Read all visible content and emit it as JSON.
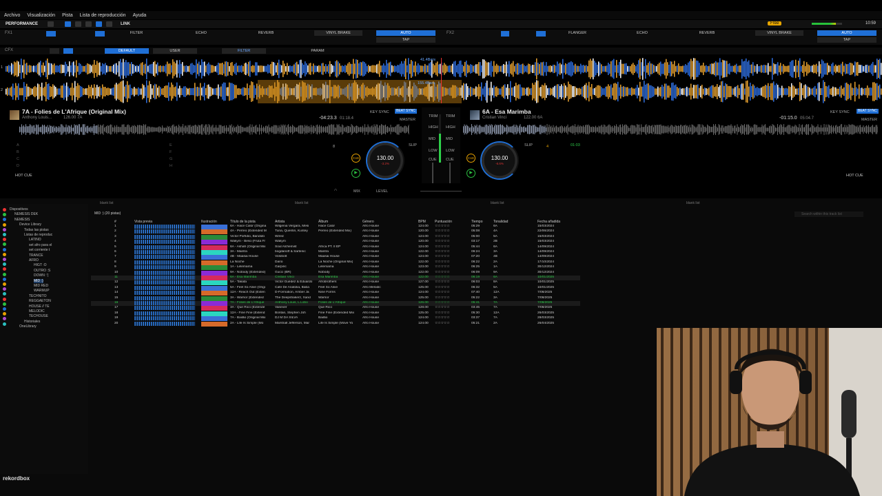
{
  "menu": [
    "Archivo",
    "Visualización",
    "Pista",
    "Lista de reproducción",
    "Ayuda"
  ],
  "toolbar": {
    "mode": "PERFORMANCE",
    "link": "LINK",
    "free": "Free",
    "clock": "10:59"
  },
  "fx": {
    "fx1_label": "FX1",
    "fx2_label": "FX2",
    "cfx_label": "CFX",
    "deck1": [
      "FILTER",
      "ECHO",
      "REVERB",
      "VINYL BRAKE"
    ],
    "deck2": [
      "FLANGER",
      "ECHO",
      "REVERB",
      "VINYL BRAKE"
    ],
    "auto": "AUTO",
    "tap": "TAP",
    "cfx_tabs": [
      "DEFAULT",
      "USER"
    ],
    "cfx_filter": "FILTER",
    "cfx_param": "PARAM"
  },
  "waveform": {
    "bars_top": "41.4Bars",
    "bars_bottom": "155.4Bars",
    "top_bars_lane": "1",
    "bottom_bars_lane": "2"
  },
  "deck1": {
    "title": "7A - Folies de L'Afrique (Original Mix)",
    "artist": "Anthony Louis...",
    "info": "126.00 7A",
    "time_remaining": "-04:23.3",
    "time_total": "01:18.4",
    "bpm": "130.00",
    "bpm_pct": "-3.2%",
    "key_sync": "KEY SYNC",
    "beat_sync": "BEAT SYNC",
    "master": "MASTER",
    "cue": "CUE",
    "hot_cue": "HOT CUE",
    "slip": "SLIP",
    "loop": "8",
    "pad_letters": [
      "A",
      "B",
      "C",
      "D"
    ],
    "pad_letters_right": [
      "E",
      "F",
      "G",
      "H"
    ]
  },
  "deck2": {
    "title": "6A - Esa Marimba",
    "artist": "Cristian Vinci",
    "info": "122.00 6A",
    "time_remaining": "-01:15.0",
    "time_total": "05:04.7",
    "bpm": "130.00",
    "bpm_pct": "-6.6%",
    "key_sync": "KEY SYNC",
    "beat_sync": "BEAT SYNC",
    "master": "MASTER",
    "cue": "CUE",
    "hot_cue": "HOT CUE",
    "slip": "SLIP",
    "loop": "4",
    "hotcue_time": "01:03"
  },
  "mixer": {
    "trim": "TRIM",
    "high": "HIGH",
    "mid": "MID",
    "low": "LOW",
    "cue": "CUE",
    "mix": "MIX",
    "level": "LEVEL"
  },
  "browser": {
    "panes": [
      "blank list",
      "blank list",
      "blank list",
      "blank list"
    ],
    "search_placeholder": "Search within this track list",
    "list_title": "MID :) (20 pistas)",
    "columns": [
      "#",
      "Vista previa",
      "Ilustración",
      "Título de la pista",
      "Artista",
      "Álbum",
      "Género",
      "BPM",
      "Puntuación",
      "Tiempo",
      "Tonalidad",
      "Fecha añadida"
    ],
    "tracks": [
      {
        "n": "1",
        "title": "6A - Hace Calor (Origina",
        "artist": "Wilgenia Vergara, Mesi",
        "album": "Hace Calor",
        "genre": "Afro House",
        "bpm": "124.00",
        "time": "05:29",
        "key": "6A",
        "date": "15/03/2024"
      },
      {
        "n": "2",
        "title": "4A - Perreo (Extended M",
        "artist": "Tuna, Quentin, Kuntey",
        "album": "Perreo (Extended Mix)",
        "genre": "Afro House",
        "bpm": "120.00",
        "time": "05:08",
        "key": "4A",
        "date": "22/06/2024"
      },
      {
        "n": "3",
        "title": "Victor Porfidio, Bandido",
        "artist": "Wired",
        "album": "",
        "genre": "Afro House",
        "bpm": "124.00",
        "time": "05:00",
        "key": "5A",
        "date": "15/03/2024"
      },
      {
        "n": "4",
        "title": "Wakym - Beso (Fruta Fr",
        "artist": "Wakym",
        "album": "",
        "genre": "Afro House",
        "bpm": "120.00",
        "time": "03:17",
        "key": "2B",
        "date": "15/03/2024"
      },
      {
        "n": "5",
        "title": "6A - Ashah (Original Mix",
        "artist": "Soul Alchemist",
        "album": "Africa PT. II EP",
        "genre": "Afro House",
        "bpm": "124.00",
        "time": "05:44",
        "key": "6A",
        "date": "14/09/2024"
      },
      {
        "n": "6",
        "title": "3A - Mantra",
        "artist": "bogdanoff & Sartenic",
        "album": "Mantra",
        "genre": "Afro House",
        "bpm": "122.00",
        "time": "06:24",
        "key": "3A",
        "date": "14/09/2024"
      },
      {
        "n": "7",
        "title": "4B - Maasai House",
        "artist": "Volobott",
        "album": "Maasai House",
        "genre": "Afro House",
        "bpm": "124.00",
        "time": "07:20",
        "key": "4B",
        "date": "14/09/2024"
      },
      {
        "n": "8",
        "title": "La Noche",
        "artist": "Dario",
        "album": "La Noche (Original Mix)",
        "genre": "Afro House",
        "bpm": "122.00",
        "time": "06:22",
        "key": "2A",
        "date": "17/10/2024"
      },
      {
        "n": "9",
        "title": "1A - Lelemama",
        "artist": "Garpinc",
        "album": "Lelemama",
        "genre": "Afro House",
        "bpm": "123.00",
        "time": "06:25",
        "key": "1A",
        "date": "30/12/2024"
      },
      {
        "n": "10",
        "title": "9A - Nobody (Extended)",
        "artist": "Gucci (BR)",
        "album": "Nobody",
        "genre": "Afro House",
        "bpm": "122.00",
        "time": "06:09",
        "key": "9A",
        "date": "30/12/2024"
      },
      {
        "n": "11",
        "title": "6A - Esa Marimba",
        "artist": "Cristian Vinci",
        "album": "Esa Marimba",
        "genre": "Afro House",
        "bpm": "122.00",
        "time": "06:19",
        "key": "6A",
        "date": "10/01/2025",
        "green": true
      },
      {
        "n": "12",
        "title": "5A - Takata",
        "artist": "Victor Guédez & Eduardo",
        "album": "Afrobrothers",
        "genre": "Afro House",
        "bpm": "127.00",
        "time": "06:03",
        "key": "8A",
        "date": "10/01/2025"
      },
      {
        "n": "13",
        "title": "5A - Feel So Alive (Origi",
        "artist": "Cafe De Anatolia, Baba",
        "album": "Feel So Alive",
        "genre": "Afro Melodic",
        "bpm": "125.00",
        "time": "06:32",
        "key": "5A",
        "date": "10/01/2025"
      },
      {
        "n": "14",
        "title": "12A - Reach Out (Exten",
        "artist": "D-Formation, Amber Ja",
        "album": "Nine Forms",
        "genre": "Afro House",
        "bpm": "124.00",
        "time": "07:40",
        "key": "12A",
        "date": "7/08/2025"
      },
      {
        "n": "15",
        "title": "3A - Warrior (Extended",
        "artist": "The Deepshakerz, Xand",
        "album": "Warrior",
        "genre": "Afro House",
        "bpm": "125.00",
        "time": "05:22",
        "key": "3A",
        "date": "7/08/2025"
      },
      {
        "n": "16",
        "title": "7A - Folies de L'Afrique",
        "artist": "Anthony Louis, L.Lobo",
        "album": "Folies de L'Afrique",
        "genre": "Afro House",
        "bpm": "126.00",
        "time": "05:41",
        "key": "7A",
        "date": "7/08/2025",
        "green": true
      },
      {
        "n": "17",
        "title": "3A - Que Rico (Extende",
        "artist": "Vanever",
        "album": "Que Rico",
        "genre": "Afro House",
        "bpm": "128.00",
        "time": "03:45",
        "key": "7A",
        "date": "7/08/2025"
      },
      {
        "n": "18",
        "title": "12A - Fine Fine (Extend",
        "artist": "Bontan, Stephen Joh",
        "album": "Fine Fine (Extended Mix",
        "genre": "Afro House",
        "bpm": "125.00",
        "time": "05:30",
        "key": "12A",
        "date": "26/03/2025"
      },
      {
        "n": "19",
        "title": "7A - Bailão (Original Mix",
        "artist": "DJ M DA SILVA",
        "album": "Bailão",
        "genre": "Afro House",
        "bpm": "124.00",
        "time": "03:37",
        "key": "7A",
        "date": "28/03/2025"
      },
      {
        "n": "20",
        "title": "2A - Life Is Simple (Mo",
        "artist": "Marshall Jefferson, Mar",
        "album": "Life Is Simple (Move Yo",
        "genre": "Afro House",
        "bpm": "124.00",
        "time": "05:21",
        "key": "2A",
        "date": "26/04/2025"
      }
    ]
  },
  "tree": [
    {
      "label": "Dispositivos",
      "indent": 0
    },
    {
      "label": "NEMESIS DEK",
      "indent": 1
    },
    {
      "label": "NEMESIS",
      "indent": 1
    },
    {
      "label": "Device Library",
      "indent": 2
    },
    {
      "label": "Todas las pistas",
      "indent": 3
    },
    {
      "label": "Listas de reproduc",
      "indent": 3
    },
    {
      "label": "LATINO",
      "indent": 4
    },
    {
      "label": "set afro para el",
      "indent": 4
    },
    {
      "label": "set corriente t",
      "indent": 4
    },
    {
      "label": "TRANCE",
      "indent": 4
    },
    {
      "label": "AFRO",
      "indent": 4
    },
    {
      "label": "HIGT :O",
      "indent": 5
    },
    {
      "label": "OUTRO :S",
      "indent": 5
    },
    {
      "label": "DOWN :'(",
      "indent": 5
    },
    {
      "label": "MID :)",
      "indent": 5,
      "sel": true
    },
    {
      "label": "MID RED",
      "indent": 5
    },
    {
      "label": "WARMUP",
      "indent": 5
    },
    {
      "label": "TECHNITO",
      "indent": 4
    },
    {
      "label": "REGGAETON",
      "indent": 4
    },
    {
      "label": "HOUSE // TE",
      "indent": 4
    },
    {
      "label": "MELODIC",
      "indent": 4
    },
    {
      "label": "TECHOUSE",
      "indent": 4
    },
    {
      "label": "Historiales",
      "indent": 3
    },
    {
      "label": "OneLibrary",
      "indent": 2
    }
  ],
  "app_logo": "rekordbox",
  "colors": {
    "accent": "#1f6fd6",
    "waveform_orange": "#e8a230",
    "green": "#2ed04a"
  }
}
